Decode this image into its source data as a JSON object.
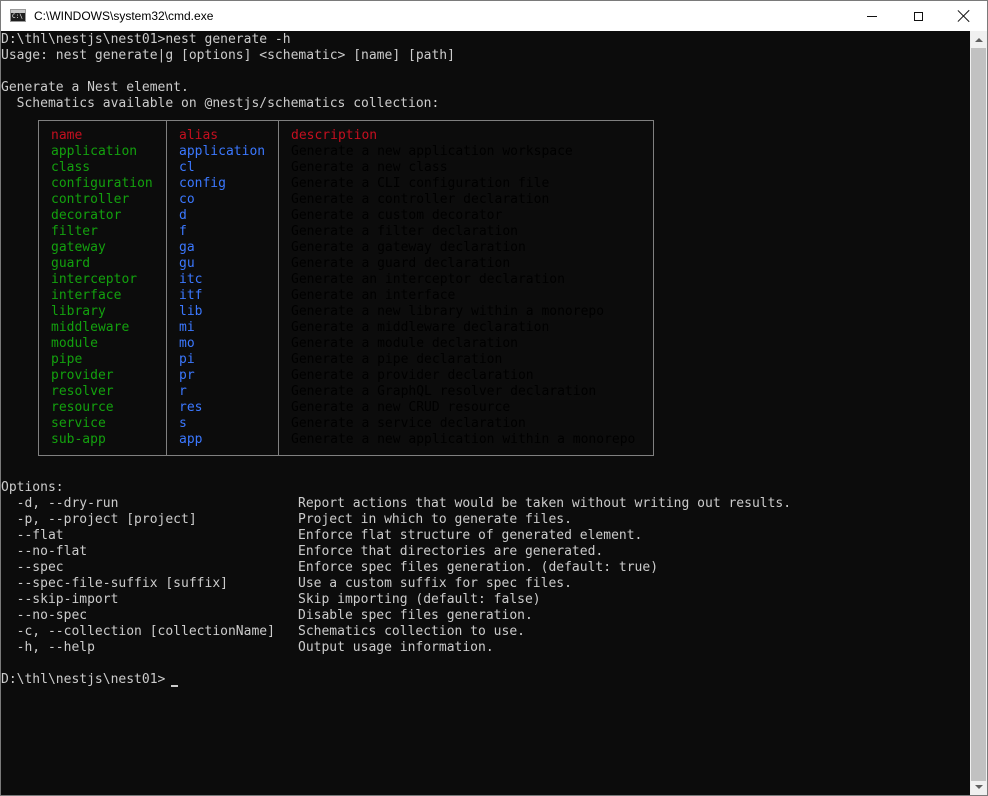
{
  "window": {
    "title": "C:\\WINDOWS\\system32\\cmd.exe",
    "icon": "cmd-icon",
    "icon_text": "C:\\"
  },
  "console": {
    "command_line": "D:\\thl\\nestjs\\nest01>nest generate -h",
    "usage": "Usage: nest generate|g [options] <schematic> [name] [path]",
    "desc1": "Generate a Nest element.",
    "desc2": "  Schematics available on @nestjs/schematics collection:",
    "table": {
      "headers": {
        "name": "name",
        "alias": "alias",
        "description": "description"
      },
      "rows": [
        {
          "name": "application",
          "alias": "application",
          "description": "Generate a new application workspace"
        },
        {
          "name": "class",
          "alias": "cl",
          "description": "Generate a new class"
        },
        {
          "name": "configuration",
          "alias": "config",
          "description": "Generate a CLI configuration file"
        },
        {
          "name": "controller",
          "alias": "co",
          "description": "Generate a controller declaration"
        },
        {
          "name": "decorator",
          "alias": "d",
          "description": "Generate a custom decorator"
        },
        {
          "name": "filter",
          "alias": "f",
          "description": "Generate a filter declaration"
        },
        {
          "name": "gateway",
          "alias": "ga",
          "description": "Generate a gateway declaration"
        },
        {
          "name": "guard",
          "alias": "gu",
          "description": "Generate a guard declaration"
        },
        {
          "name": "interceptor",
          "alias": "itc",
          "description": "Generate an interceptor declaration"
        },
        {
          "name": "interface",
          "alias": "itf",
          "description": "Generate an interface"
        },
        {
          "name": "library",
          "alias": "lib",
          "description": "Generate a new library within a monorepo"
        },
        {
          "name": "middleware",
          "alias": "mi",
          "description": "Generate a middleware declaration"
        },
        {
          "name": "module",
          "alias": "mo",
          "description": "Generate a module declaration"
        },
        {
          "name": "pipe",
          "alias": "pi",
          "description": "Generate a pipe declaration"
        },
        {
          "name": "provider",
          "alias": "pr",
          "description": "Generate a provider declaration"
        },
        {
          "name": "resolver",
          "alias": "r",
          "description": "Generate a GraphQL resolver declaration"
        },
        {
          "name": "resource",
          "alias": "res",
          "description": "Generate a new CRUD resource"
        },
        {
          "name": "service",
          "alias": "s",
          "description": "Generate a service declaration"
        },
        {
          "name": "sub-app",
          "alias": "app",
          "description": "Generate a new application within a monorepo"
        }
      ]
    },
    "options_header": "Options:",
    "options": [
      {
        "flag": "  -d, --dry-run",
        "description": "Report actions that would be taken without writing out results."
      },
      {
        "flag": "  -p, --project [project]",
        "description": "Project in which to generate files."
      },
      {
        "flag": "  --flat",
        "description": "Enforce flat structure of generated element."
      },
      {
        "flag": "  --no-flat",
        "description": "Enforce that directories are generated."
      },
      {
        "flag": "  --spec",
        "description": "Enforce spec files generation. (default: true)"
      },
      {
        "flag": "  --spec-file-suffix [suffix]",
        "description": "Use a custom suffix for spec files."
      },
      {
        "flag": "  --skip-import",
        "description": "Skip importing (default: false)"
      },
      {
        "flag": "  --no-spec",
        "description": "Disable spec files generation."
      },
      {
        "flag": "  -c, --collection [collectionName]",
        "description": "Schematics collection to use."
      },
      {
        "flag": "  -h, --help",
        "description": "Output usage information."
      }
    ],
    "prompt": "D:\\thl\\nestjs\\nest01>"
  },
  "colors": {
    "background": "#0c0c0c",
    "text": "#cccccc",
    "name": "#13a10e",
    "alias": "#3b78ff",
    "header": "#c50f1f",
    "border": "#808080"
  }
}
